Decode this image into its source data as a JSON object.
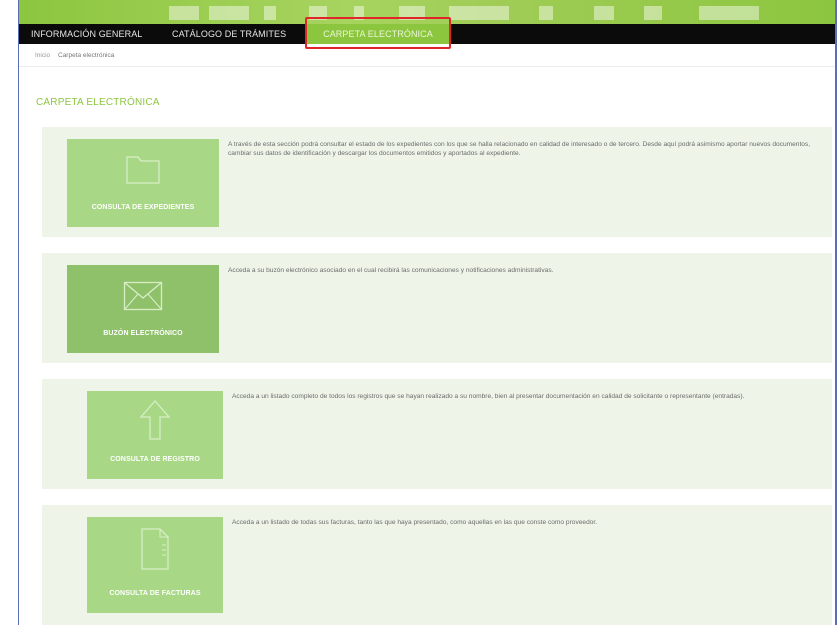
{
  "nav": {
    "items": [
      {
        "label": "INFORMACIÓN GENERAL"
      },
      {
        "label": "CATÁLOGO DE TRÁMITES"
      },
      {
        "label": "CARPETA ELECTRÓNICA"
      }
    ]
  },
  "breadcrumb": {
    "home": "Inicio",
    "current": "Carpeta electrónica"
  },
  "page": {
    "title": "CARPETA ELECTRÓNICA"
  },
  "cards": [
    {
      "label": "CONSULTA DE EXPEDIENTES",
      "icon": "folder-icon",
      "description": "A través de esta sección podrá consultar el estado de los expedientes con los que se halla relacionado en calidad de interesado o de tercero. Desde aquí podrá asimismo aportar nuevos documentos, cambiar sus datos de identificación y descargar los documentos emitidos y aportados al expediente."
    },
    {
      "label": "BUZÓN ELECTRÓNICO",
      "icon": "envelope-icon",
      "description": "Acceda a su buzón electrónico asociado en el cual recibirá las comunicaciones y notificaciones administrativas."
    },
    {
      "label": "CONSULTA DE REGISTRO",
      "icon": "arrow-up-icon",
      "description": "Acceda a un listado completo de todos los registros que se hayan realizado a su nombre, bien al presentar documentación en calidad de solicitante o representante (entradas)."
    },
    {
      "label": "CONSULTA DE FACTURAS",
      "icon": "document-icon",
      "description": "Acceda a un listado de todas sus facturas, tanto las que haya presentado, como aquellas en las que conste como proveedor."
    }
  ],
  "colors": {
    "brand_green": "#8cc63f",
    "tile_green": "#a8d886",
    "card_bg": "#eef5e8",
    "highlight_red": "#e0262a"
  }
}
